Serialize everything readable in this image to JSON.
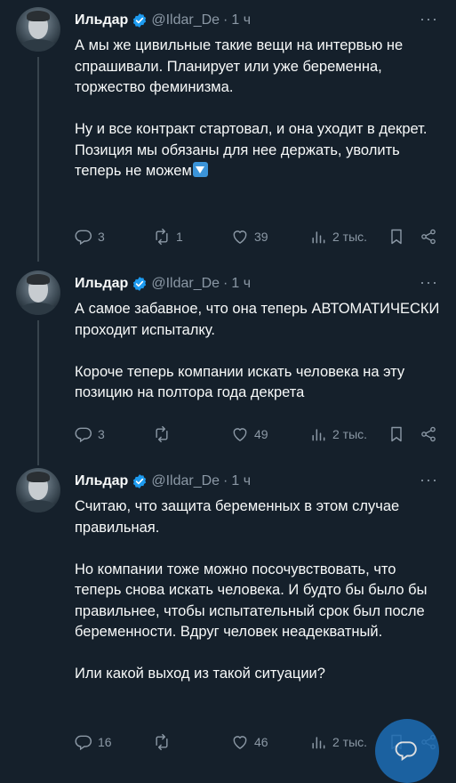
{
  "tweets": [
    {
      "author": "Ильдар",
      "handle": "@Ildar_De",
      "dot": "·",
      "time": "1 ч",
      "paragraphs": [
        "А мы же цивильные такие вещи на интервью не спрашивали. Планирует или уже беременна, торжество феминизма.",
        "Ну и все контракт стартовал, и она уходит в декрет.",
        "Позиция мы обязаны для нее держать, уволить теперь не можем"
      ],
      "replies": "3",
      "retweets": "1",
      "likes": "39",
      "views": "2 тыс."
    },
    {
      "author": "Ильдар",
      "handle": "@Ildar_De",
      "dot": "·",
      "time": "1 ч",
      "paragraphs": [
        "А самое забавное, что она теперь АВТОМАТИЧЕСКИ проходит испыталку.",
        "Короче теперь компании искать человека на эту позицию на полтора года декрета"
      ],
      "replies": "3",
      "retweets": "",
      "likes": "49",
      "views": "2 тыс."
    },
    {
      "author": "Ильдар",
      "handle": "@Ildar_De",
      "dot": "·",
      "time": "1 ч",
      "paragraphs": [
        "Считаю, что защита беременных в этом случае правильная.",
        "Но компании тоже можно посочувствовать, что теперь снова искать человека. И будто бы было бы правильнее, чтобы испытательный срок был после беременности. Вдруг человек неадекватный.",
        "Или какой выход из такой ситуации?"
      ],
      "replies": "16",
      "retweets": "",
      "likes": "46",
      "views": "2 тыс."
    }
  ],
  "icons": {
    "verified": "verified-badge-icon",
    "more": "more-icon",
    "reply": "reply-icon",
    "retweet": "retweet-icon",
    "like": "heart-icon",
    "views": "views-icon",
    "bookmark": "bookmark-icon",
    "share": "share-icon"
  },
  "colors": {
    "background": "#15202b",
    "text": "#f7f9f9",
    "muted": "#8b98a5",
    "accent": "#1d9bf0"
  }
}
